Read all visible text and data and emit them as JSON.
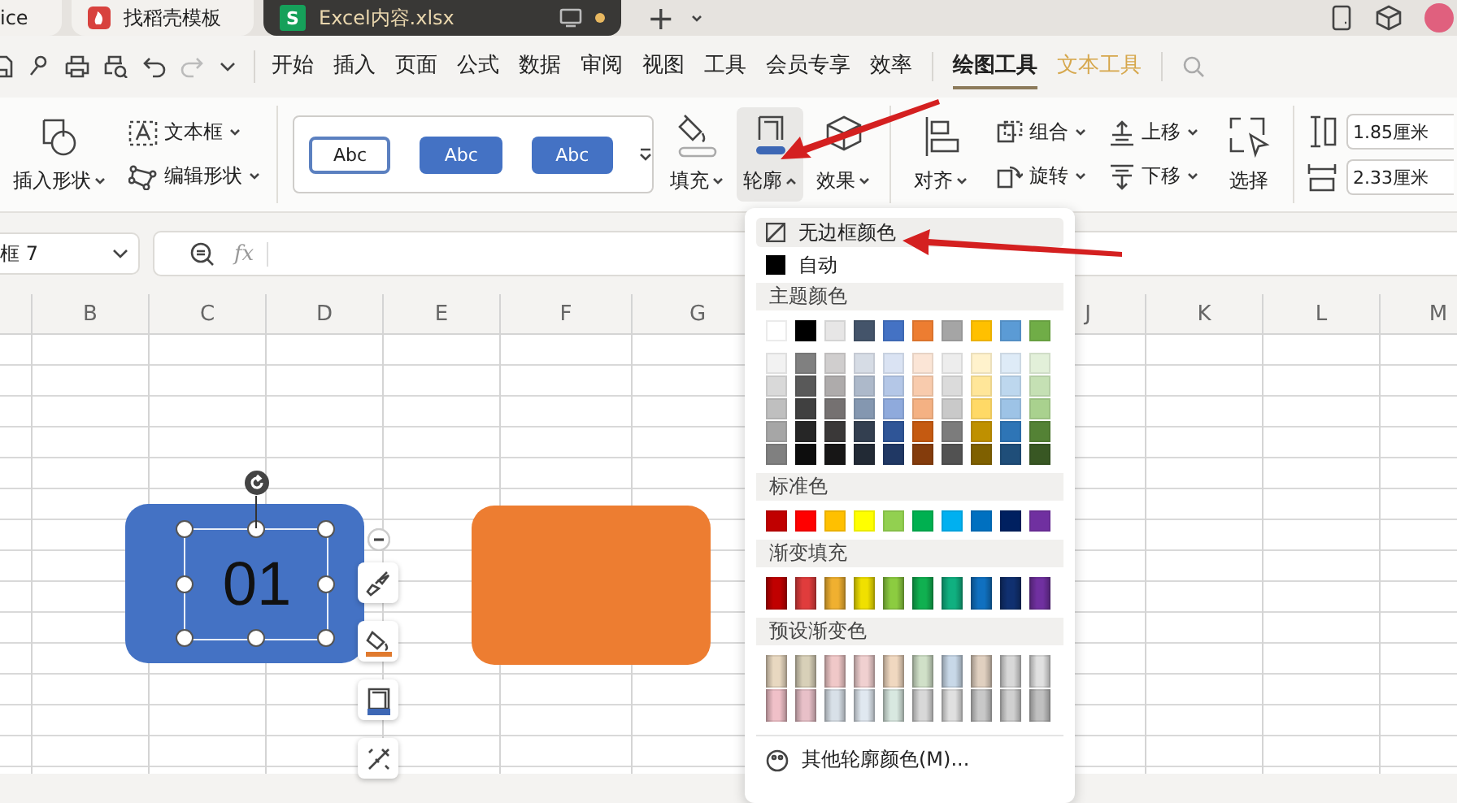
{
  "tabs": [
    {
      "label": "ice",
      "selected": false
    },
    {
      "label": "找稻壳模板",
      "selected": false
    },
    {
      "label": "Excel内容.xlsx",
      "icon_letter": "S",
      "selected": true,
      "modified": true
    }
  ],
  "new_tab": "+",
  "menu_bar": [
    {
      "label": "开始",
      "contextual": false,
      "selected": false
    },
    {
      "label": "插入",
      "contextual": false,
      "selected": false
    },
    {
      "label": "页面",
      "contextual": false,
      "selected": false
    },
    {
      "label": "公式",
      "contextual": false,
      "selected": false
    },
    {
      "label": "数据",
      "contextual": false,
      "selected": false
    },
    {
      "label": "审阅",
      "contextual": false,
      "selected": false
    },
    {
      "label": "视图",
      "contextual": false,
      "selected": false
    },
    {
      "label": "工具",
      "contextual": false,
      "selected": false
    },
    {
      "label": "会员专享",
      "contextual": false,
      "selected": false
    },
    {
      "label": "效率",
      "contextual": false,
      "selected": false
    },
    {
      "label": "绘图工具",
      "contextual": true,
      "selected": true
    },
    {
      "label": "文本工具",
      "contextual": true,
      "selected": false
    }
  ],
  "ribbon": {
    "insert_shape": "插入形状",
    "text_box": "文本框",
    "edit_shape": "编辑形状",
    "styles": [
      {
        "label": "Abc",
        "kind": "outline"
      },
      {
        "label": "Abc",
        "kind": "filled"
      },
      {
        "label": "Abc",
        "kind": "filled"
      }
    ],
    "format_buttons": [
      {
        "label": "填充",
        "open": false
      },
      {
        "label": "轮廓",
        "open": true
      },
      {
        "label": "效果",
        "open": false
      }
    ],
    "align": "对齐",
    "arrange": [
      "组合",
      "旋转",
      "上移",
      "下移"
    ],
    "select": "选择",
    "size_fields": [
      {
        "value": "1.85厘米"
      },
      {
        "value": "2.33厘米"
      }
    ]
  },
  "sheet": {
    "name_box": "框 7",
    "formula_label": "fx",
    "columns": [
      "B",
      "C",
      "D",
      "E",
      "F",
      "G",
      "J",
      "K",
      "L",
      "M"
    ],
    "shapes": [
      {
        "color": "#4472c4",
        "text": "01",
        "selected": true
      },
      {
        "color": "#ed7d31",
        "selected": false
      }
    ]
  },
  "outline_menu": {
    "items": [
      {
        "label": "无边框颜色",
        "kind": "none",
        "highlighted": true
      },
      {
        "label": "自动",
        "kind": "auto",
        "highlighted": false
      }
    ],
    "sections": [
      {
        "title": "主题颜色",
        "kind": "theme",
        "rows": [
          [
            {
              "color": "#ffffff"
            },
            {
              "color": "#000000"
            },
            {
              "color": "#e7e6e6"
            },
            {
              "color": "#44546a"
            },
            {
              "color": "#4472c4"
            },
            {
              "color": "#ed7d31"
            },
            {
              "color": "#a5a5a5"
            },
            {
              "color": "#ffc000"
            },
            {
              "color": "#5b9bd5"
            },
            {
              "color": "#70ad47"
            }
          ],
          [
            {
              "color": "#f2f2f2"
            },
            {
              "color": "#808080"
            },
            {
              "color": "#d0cece"
            },
            {
              "color": "#d6dce5"
            },
            {
              "color": "#dae3f3"
            },
            {
              "color": "#fbe5d6"
            },
            {
              "color": "#ededed"
            },
            {
              "color": "#fff2cc"
            },
            {
              "color": "#deebf7"
            },
            {
              "color": "#e2f0d9"
            }
          ],
          [
            {
              "color": "#d9d9d9"
            },
            {
              "color": "#595959"
            },
            {
              "color": "#aeabab"
            },
            {
              "color": "#adb9ca"
            },
            {
              "color": "#b4c7e7"
            },
            {
              "color": "#f8cbad"
            },
            {
              "color": "#dbdbdb"
            },
            {
              "color": "#ffe699"
            },
            {
              "color": "#bdd7ee"
            },
            {
              "color": "#c5e0b4"
            }
          ],
          [
            {
              "color": "#bfbfbf"
            },
            {
              "color": "#404040"
            },
            {
              "color": "#757171"
            },
            {
              "color": "#8497b0"
            },
            {
              "color": "#8faadc"
            },
            {
              "color": "#f4b183"
            },
            {
              "color": "#c9c9c9"
            },
            {
              "color": "#ffd966"
            },
            {
              "color": "#9dc3e6"
            },
            {
              "color": "#a9d18e"
            }
          ],
          [
            {
              "color": "#a6a6a6"
            },
            {
              "color": "#262626"
            },
            {
              "color": "#3a3838"
            },
            {
              "color": "#333f50"
            },
            {
              "color": "#2f5597"
            },
            {
              "color": "#c55a11"
            },
            {
              "color": "#7c7c7c"
            },
            {
              "color": "#bf9000"
            },
            {
              "color": "#2e75b6"
            },
            {
              "color": "#548235"
            }
          ],
          [
            {
              "color": "#808080"
            },
            {
              "color": "#0d0d0d"
            },
            {
              "color": "#171616"
            },
            {
              "color": "#222a35"
            },
            {
              "color": "#203864"
            },
            {
              "color": "#843c0c"
            },
            {
              "color": "#525252"
            },
            {
              "color": "#7f6000"
            },
            {
              "color": "#1f4e79"
            },
            {
              "color": "#385723"
            }
          ]
        ]
      },
      {
        "title": "标准色",
        "kind": "plain",
        "rows": [
          [
            {
              "color": "#c00000"
            },
            {
              "color": "#ff0000"
            },
            {
              "color": "#ffc000"
            },
            {
              "color": "#ffff00"
            },
            {
              "color": "#92d050"
            },
            {
              "color": "#00b050"
            },
            {
              "color": "#00b0f0"
            },
            {
              "color": "#0070c0"
            },
            {
              "color": "#002060"
            },
            {
              "color": "#7030a0"
            }
          ]
        ]
      },
      {
        "title": "渐变填充",
        "kind": "gradient",
        "rows": [
          [
            {
              "color": "#c00000"
            },
            {
              "color": "#e03c3c"
            },
            {
              "color": "#f0b030"
            },
            {
              "color": "#f0e000"
            },
            {
              "color": "#8ccc40"
            },
            {
              "color": "#10b050"
            },
            {
              "color": "#10b080"
            },
            {
              "color": "#1070c0"
            },
            {
              "color": "#103070"
            },
            {
              "color": "#7030a0"
            }
          ]
        ]
      },
      {
        "title": "预设渐变色",
        "kind": "gradient",
        "rows": [
          [
            {
              "color": "#e8d8c0"
            },
            {
              "color": "#d8d0b8"
            },
            {
              "color": "#f0c8c8"
            },
            {
              "color": "#f0d0d0"
            },
            {
              "color": "#f0d8c0"
            },
            {
              "color": "#d0e0c8"
            },
            {
              "color": "#c8d8e8"
            },
            {
              "color": "#e0d0c0"
            },
            {
              "color": "#d8d8d8"
            },
            {
              "color": "#e0e0e0"
            }
          ],
          [
            {
              "color": "#f0c0c8"
            },
            {
              "color": "#e8c0c8"
            },
            {
              "color": "#d8e0e8"
            },
            {
              "color": "#e0e8f0"
            },
            {
              "color": "#d8e8e0"
            },
            {
              "color": "#d8d8d8"
            },
            {
              "color": "#e0e0e0"
            },
            {
              "color": "#c8c8c8"
            },
            {
              "color": "#d0d0d0"
            },
            {
              "color": "#c0c0c0"
            }
          ]
        ]
      }
    ],
    "more": "其他轮廓颜色(M)..."
  }
}
